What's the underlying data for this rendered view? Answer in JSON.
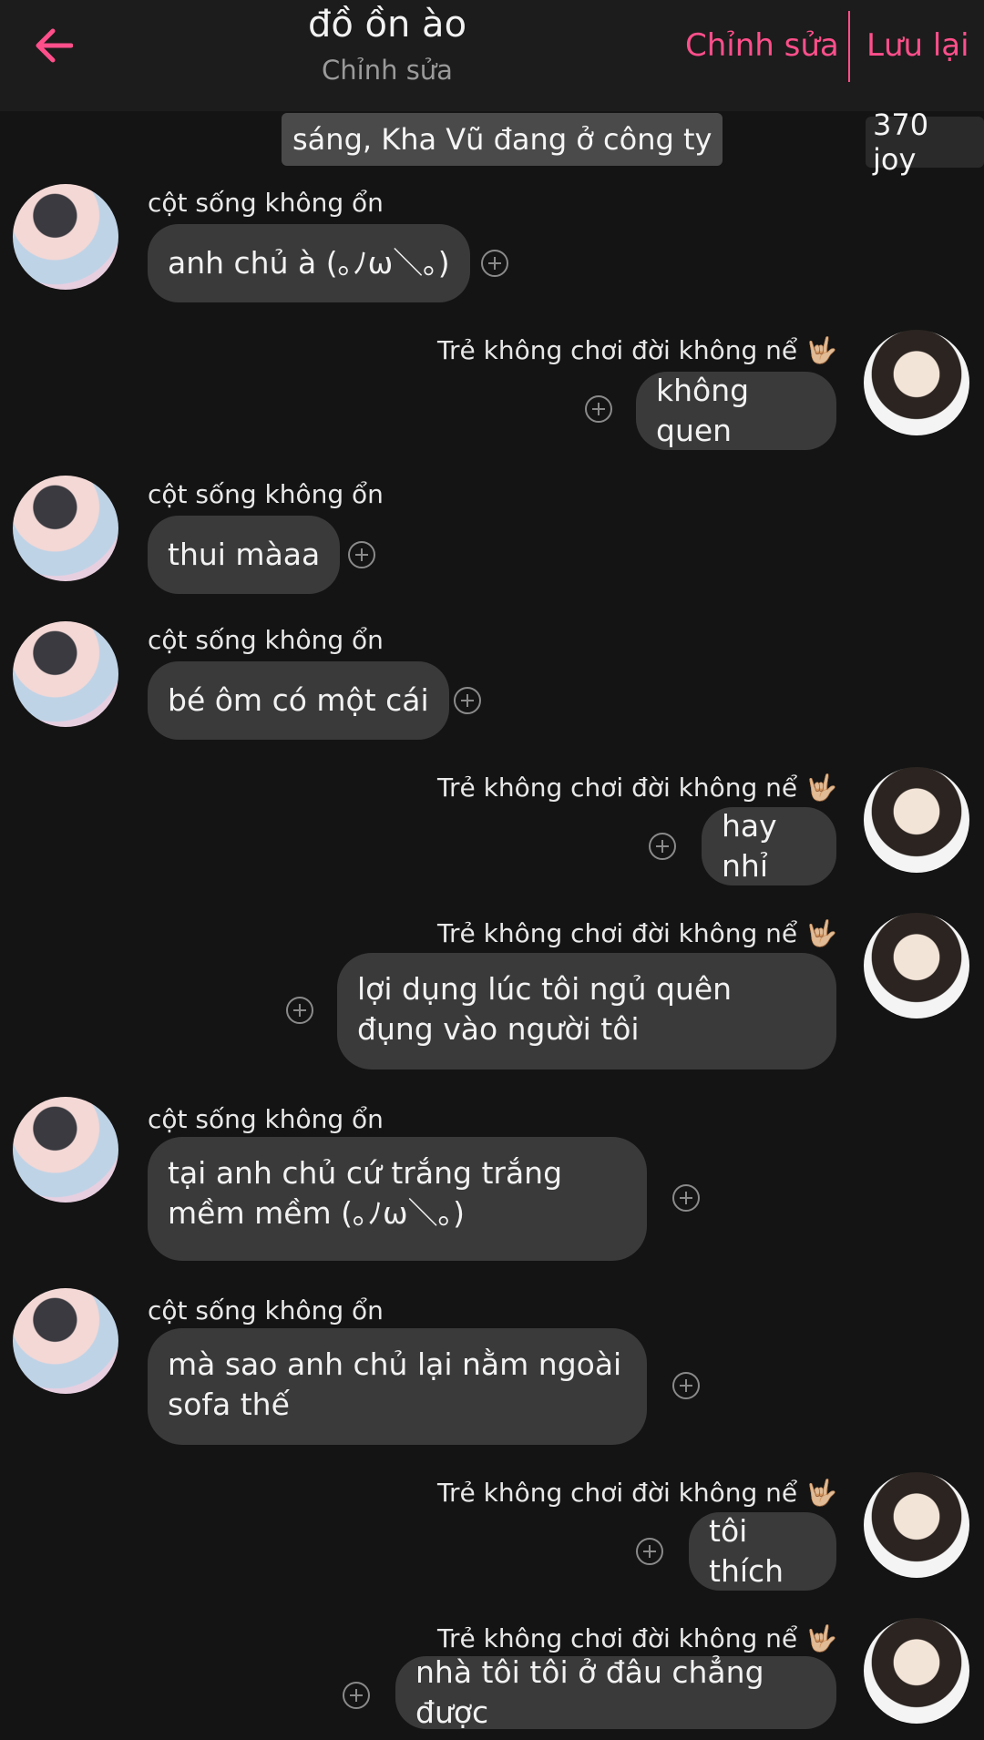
{
  "header": {
    "title": "đồ ồn ào",
    "subtitle": "Chỉnh sửa",
    "edit_label": "Chỉnh sửa",
    "save_label": "Lưu lại"
  },
  "scene": {
    "banner": "sáng, Kha Vũ đang ở công ty",
    "joy": "370 joy"
  },
  "senders": {
    "left": "cột sống không ổn",
    "right": "Trẻ không chơi đời không nể 🤟🏼"
  },
  "messages": [
    {
      "side": "left",
      "text": "anh chủ à (｡ﾉω＼｡)"
    },
    {
      "side": "right",
      "text": "không quen"
    },
    {
      "side": "left",
      "text": "thui màaa"
    },
    {
      "side": "left",
      "text": "bé ôm có một cái"
    },
    {
      "side": "right",
      "text": "hay nhỉ"
    },
    {
      "side": "right",
      "text": "lợi dụng lúc tôi ngủ quên đụng vào người tôi"
    },
    {
      "side": "left",
      "text": "tại anh chủ cứ trắng trắng mềm mềm (｡ﾉω＼｡)"
    },
    {
      "side": "left",
      "text": "mà sao anh chủ lại nằm ngoài sofa thế"
    },
    {
      "side": "right",
      "text": "tôi thích"
    },
    {
      "side": "right",
      "text": "nhà tôi tôi ở đâu chẳng được"
    }
  ],
  "colors": {
    "accent": "#ff4f8b",
    "background": "#141414",
    "bubble": "#3a3a3a"
  }
}
